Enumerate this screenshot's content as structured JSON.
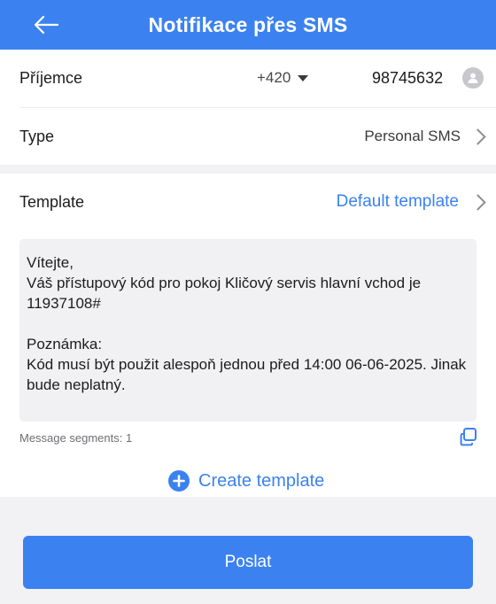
{
  "header": {
    "title": "Notifikace přes SMS",
    "back_icon": "arrow-left-icon"
  },
  "recipient": {
    "label": "Příjemce",
    "country_code": "+420",
    "phone": "98745632",
    "contact_icon": "person-icon"
  },
  "type": {
    "label": "Type",
    "value": "Personal SMS"
  },
  "template": {
    "label": "Template",
    "value": "Default template"
  },
  "message": {
    "text": "Vítejte,\nVáš přístupový kód pro pokoj Kličový servis hlavní vchod je 11937108#\n\nPoznámka:\nKód musí být použit alespoň jednou před 14:00 06-06-2025. Jinak bude neplatný.",
    "segments_label": "Message segments: 1"
  },
  "create_template": {
    "label": "Create template"
  },
  "send_button": {
    "label": "Poslat"
  },
  "colors": {
    "accent": "#3b82f0",
    "background": "#f2f2f4"
  }
}
